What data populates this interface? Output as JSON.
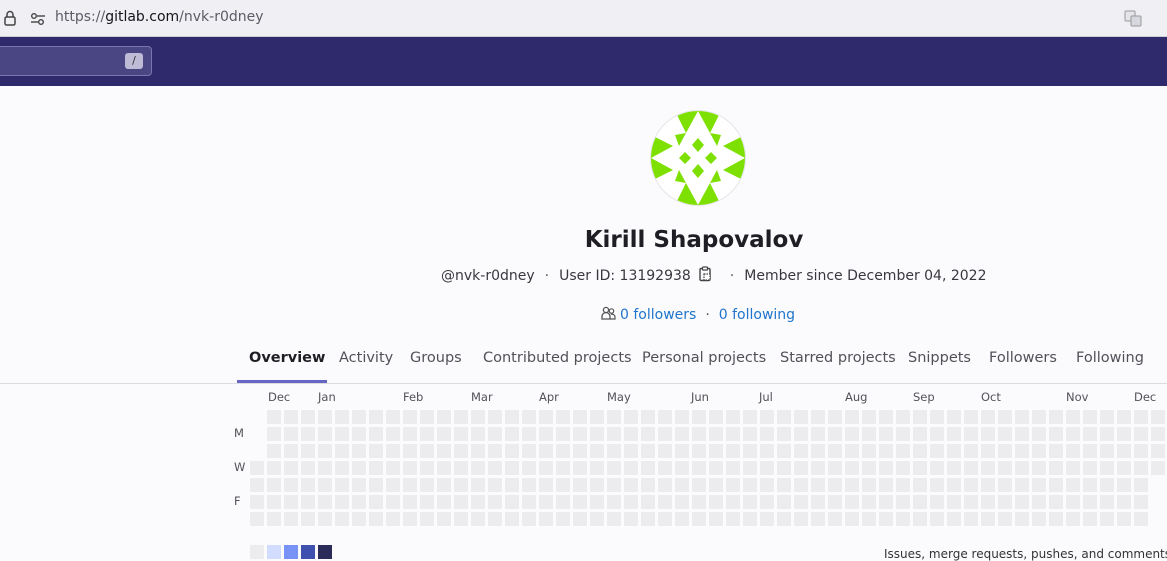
{
  "browser": {
    "url_scheme": "https://",
    "url_host": "gitlab.com",
    "url_path": "/nvk-r0dney"
  },
  "search": {
    "shortcut": "/"
  },
  "profile": {
    "name": "Kirill Shapovalov",
    "username": "@nvk-r0dney",
    "user_id": "User ID: 13192938",
    "member_since": "Member since December 04, 2022",
    "followers": "0 followers",
    "following": "0 following",
    "avatar_color": "#7ee000"
  },
  "tabs": [
    {
      "label": "Overview",
      "active": true
    },
    {
      "label": "Activity"
    },
    {
      "label": "Groups"
    },
    {
      "label": "Contributed projects"
    },
    {
      "label": "Personal projects"
    },
    {
      "label": "Starred projects"
    },
    {
      "label": "Snippets"
    },
    {
      "label": "Followers"
    },
    {
      "label": "Following"
    }
  ],
  "calendar": {
    "months": [
      "Dec",
      "Jan",
      "Feb",
      "Mar",
      "Apr",
      "May",
      "Jun",
      "Jul",
      "Aug",
      "Sep",
      "Oct",
      "Nov",
      "Dec"
    ],
    "days": [
      "M",
      "W",
      "F"
    ],
    "legend_colors": [
      "#ececef",
      "#d2dcff",
      "#7992f5",
      "#3f51ae",
      "#2a2b59"
    ],
    "legend_note": "Issues, merge requests, pushes, and comments."
  }
}
